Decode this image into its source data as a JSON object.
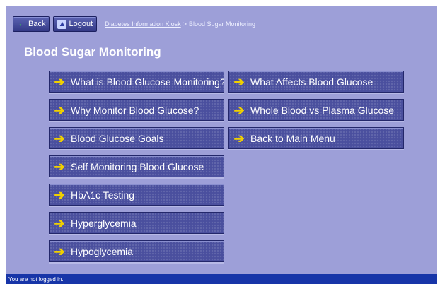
{
  "toolbar": {
    "back_label": "Back",
    "logout_label": "Logout"
  },
  "breadcrumb": {
    "link": "Diabetes Information Kiosk",
    "separator": ">",
    "current": "Blood Sugar Monitoring"
  },
  "page": {
    "title": "Blood Sugar Monitoring"
  },
  "menu": {
    "arrow_glyph": "➔",
    "left": [
      "What is Blood Glucose Monitoring?",
      "Why Monitor Blood Glucose?",
      "Blood Glucose Goals",
      "Self Monitoring Blood Glucose",
      "HbA1c Testing",
      "Hyperglycemia",
      "Hypoglycemia"
    ],
    "right": [
      "What Affects Blood Glucose",
      "Whole Blood vs Plasma Glucose",
      "Back to Main Menu"
    ]
  },
  "status": {
    "text": "You are not logged in."
  },
  "colors": {
    "background": "#9d9fd8",
    "button": "#4a4f9e",
    "arrow": "#f0d000",
    "status_bar": "#1735a8"
  },
  "icons": {
    "back": "arrow-left-icon",
    "logout": "logout-icon",
    "menu_item": "arrow-right-icon"
  }
}
